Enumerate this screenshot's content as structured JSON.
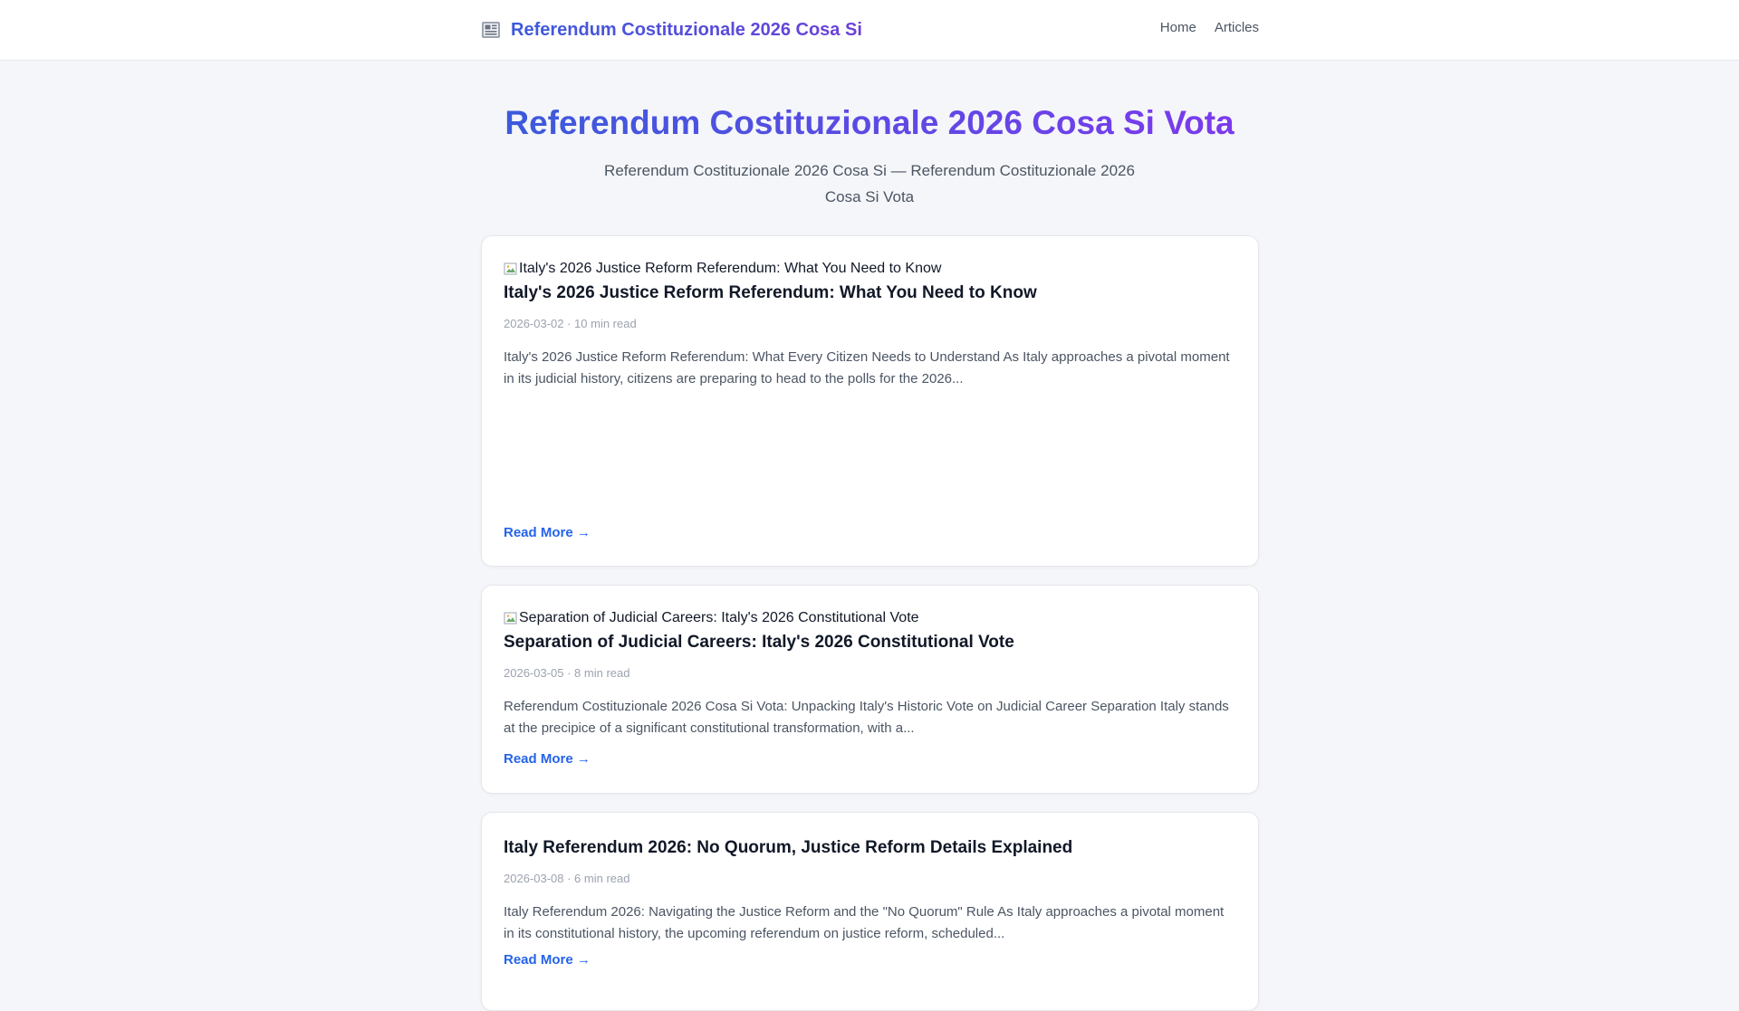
{
  "header": {
    "brand_icon": "newspaper-icon",
    "brand": "Referendum Costituzionale 2026 Cosa Si",
    "nav": [
      {
        "label": "Home"
      },
      {
        "label": "Articles"
      }
    ]
  },
  "hero": {
    "title": "Referendum Costituzionale 2026 Cosa Si Vota",
    "subtitle": "Referendum Costituzionale 2026 Cosa Si — Referendum Costituzionale 2026 Cosa Si Vota"
  },
  "articles": [
    {
      "image_alt": "Italy's 2026 Justice Reform Referendum: What You Need to Know",
      "title": "Italy's 2026 Justice Reform Referendum: What You Need to Know",
      "meta": "2026-03-02 · 10 min read",
      "excerpt": "Italy's 2026 Justice Reform Referendum: What Every Citizen Needs to Understand As Italy approaches a pivotal moment in its judicial history, citizens are preparing to head to the polls for the 2026...",
      "read_more": "Read More →"
    },
    {
      "image_alt": "Separation of Judicial Careers: Italy's 2026 Constitutional Vote",
      "title": "Separation of Judicial Careers: Italy's 2026 Constitutional Vote",
      "meta": "2026-03-05 · 8 min read",
      "excerpt": "Referendum Costituzionale 2026 Cosa Si Vota: Unpacking Italy's Historic Vote on Judicial Career Separation Italy stands at the precipice of a significant constitutional transformation, with a...",
      "read_more": "Read More →"
    },
    {
      "title": "Italy Referendum 2026: No Quorum, Justice Reform Details Explained",
      "meta": "2026-03-08 · 6 min read",
      "excerpt": "Italy Referendum 2026: Navigating the Justice Reform and the \"No Quorum\" Rule As Italy approaches a pivotal moment in its constitutional history, the upcoming referendum on justice reform, scheduled...",
      "read_more": "Read More →"
    }
  ]
}
